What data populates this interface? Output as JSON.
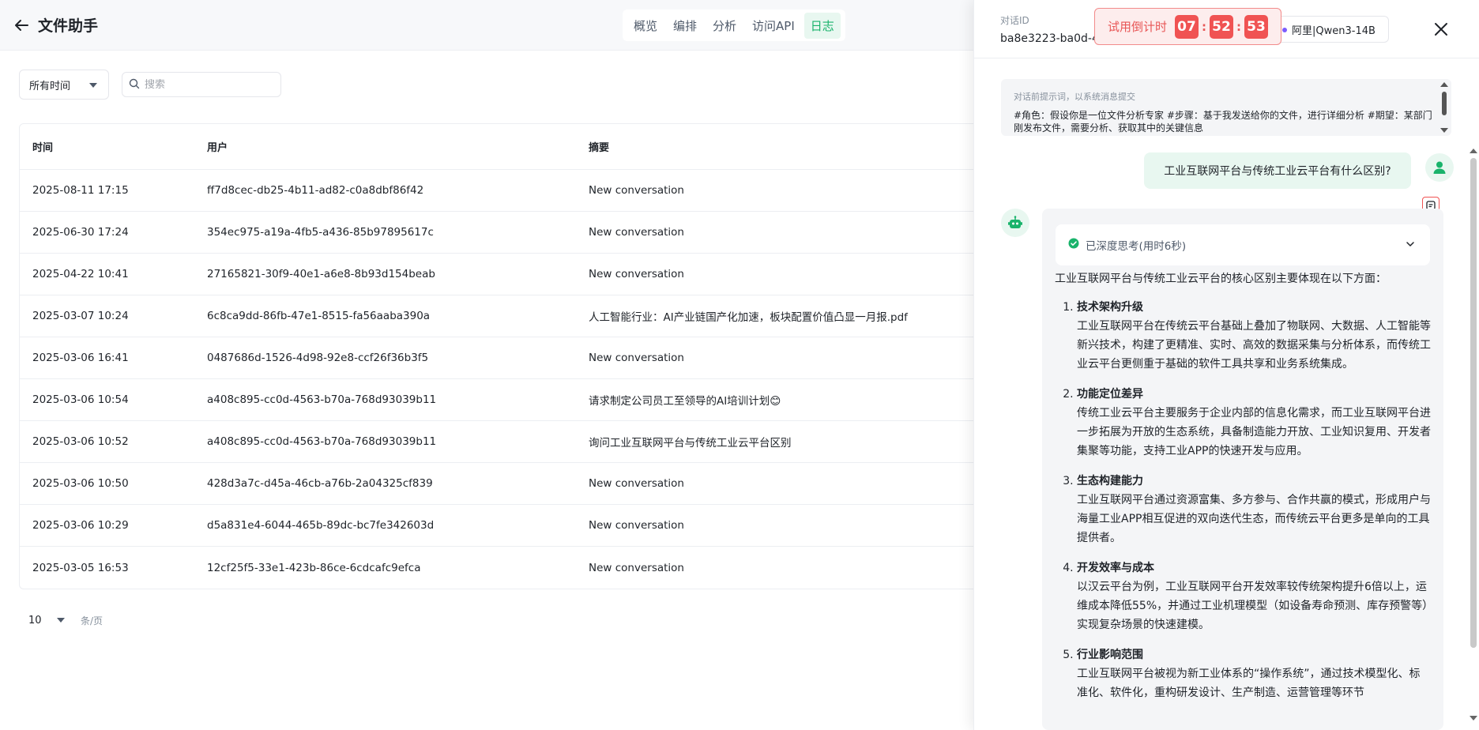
{
  "header": {
    "title": "文件助手",
    "tabs": [
      {
        "label": "概览",
        "active": false
      },
      {
        "label": "编排",
        "active": false
      },
      {
        "label": "分析",
        "active": false
      },
      {
        "label": "访问API",
        "active": false
      },
      {
        "label": "日志",
        "active": true
      }
    ]
  },
  "filters": {
    "time_range": "所有时间",
    "search_placeholder": "搜索"
  },
  "table": {
    "columns": [
      "时间",
      "用户",
      "摘要"
    ],
    "rows": [
      {
        "time": "2025-08-11 17:15",
        "user": "ff7d8cec-db25-4b11-ad82-c0a8dbf86f42",
        "summary": "New conversation"
      },
      {
        "time": "2025-06-30 17:24",
        "user": "354ec975-a19a-4fb5-a436-85b97895617c",
        "summary": "New conversation"
      },
      {
        "time": "2025-04-22 10:41",
        "user": "27165821-30f9-40e1-a6e8-8b93d154beab",
        "summary": "New conversation"
      },
      {
        "time": "2025-03-07 10:24",
        "user": "6c8ca9dd-86fb-47e1-8515-fa56aaba390a",
        "summary": "人工智能行业：AI产业链国产化加速，板块配置价值凸显一月报.pdf"
      },
      {
        "time": "2025-03-06 16:41",
        "user": "0487686d-1526-4d98-92e8-ccf26f36b3f5",
        "summary": "New conversation"
      },
      {
        "time": "2025-03-06 10:54",
        "user": "a408c895-cc0d-4563-b70a-768d93039b11",
        "summary": "请求制定公司员工至领导的AI培训计划😊"
      },
      {
        "time": "2025-03-06 10:52",
        "user": "a408c895-cc0d-4563-b70a-768d93039b11",
        "summary": "询问工业互联网平台与传统工业云平台区别"
      },
      {
        "time": "2025-03-06 10:50",
        "user": "428d3a7c-d45a-46cb-a76b-2a04325cf839",
        "summary": "New conversation"
      },
      {
        "time": "2025-03-06 10:29",
        "user": "d5a831e4-6044-465b-89dc-bc7fe342603d",
        "summary": "New conversation"
      },
      {
        "time": "2025-03-05 16:53",
        "user": "12cf25f5-33e1-423b-86ce-6cdcafc9efca",
        "summary": "New conversation"
      }
    ]
  },
  "pagination": {
    "page_size": "10",
    "unit": "条/页"
  },
  "drawer": {
    "conv_id_label": "对话ID",
    "conv_id_value": "ba8e3223-ba0d-4",
    "trial": {
      "label": "试用倒计时",
      "hours": "07",
      "minutes": "52",
      "seconds": "53",
      "sep": ":"
    },
    "model": "阿里|Qwen3-14B",
    "system_prompt": {
      "title": "对话前提示词，以系统消息提交",
      "text": "#角色：假设你是一位文件分析专家 #步骤：基于我发送给你的文件，进行详细分析 #期望：某部门刚发布文件，需要分析、获取其中的关键信息"
    },
    "user_message": "工业互联网平台与传统工业云平台有什么区别?",
    "thinking": "已深度思考(用时6秒)",
    "answer": {
      "intro": "工业互联网平台与传统工业云平台的核心区别主要体现在以下方面：",
      "items": [
        {
          "title": "技术架构升级",
          "body": "工业互联网平台在传统云平台基础上叠加了物联网、大数据、人工智能等新兴技术，构建了更精准、实时、高效的数据采集与分析体系，而传统工业云平台更侧重于基础的软件工具共享和业务系统集成。"
        },
        {
          "title": "功能定位差异",
          "body": "传统工业云平台主要服务于企业内部的信息化需求，而工业互联网平台进一步拓展为开放的生态系统，具备制造能力开放、工业知识复用、开发者集聚等功能，支持工业APP的快速开发与应用。"
        },
        {
          "title": "生态构建能力",
          "body": "工业互联网平台通过资源富集、多方参与、合作共赢的模式，形成用户与海量工业APP相互促进的双向迭代生态，而传统云平台更多是单向的工具提供者。"
        },
        {
          "title": "开发效率与成本",
          "body": "以汉云平台为例，工业互联网平台开发效率较传统架构提升6倍以上，运维成本降低55%，并通过工业机理模型（如设备寿命预测、库存预警等）实现复杂场景的快速建模。"
        },
        {
          "title": "行业影响范围",
          "body": "工业互联网平台被视为新工业体系的“操作系统”，通过技术模型化、标准化、软件化，重构研发设计、生产制造、运营管理等环节"
        }
      ]
    }
  },
  "colors": {
    "accent": "#19b36b",
    "accent_bg": "#e8f7f0",
    "trial_red": "#f05353"
  }
}
